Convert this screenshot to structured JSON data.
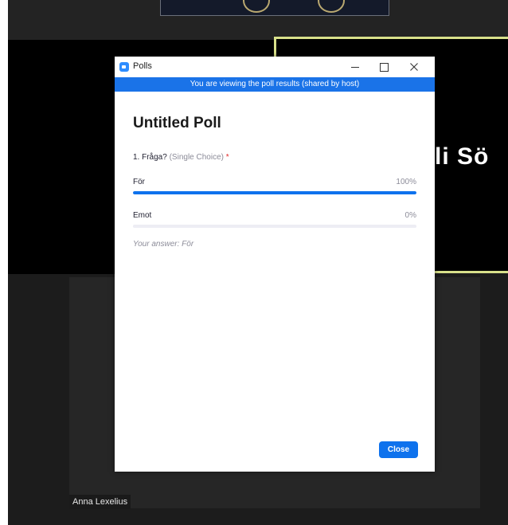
{
  "window": {
    "title": "Polls"
  },
  "banner": {
    "text": "You are viewing the poll results (shared by host)"
  },
  "poll": {
    "title": "Untitled Poll",
    "question": {
      "number_text": "1. Fråga?",
      "type": "(Single Choice)",
      "required_marker": "*"
    },
    "options": [
      {
        "label": "För",
        "percent_text": "100%",
        "percent": 100
      },
      {
        "label": "Emot",
        "percent_text": "0%",
        "percent": 0
      }
    ],
    "your_answer": "Your answer: För",
    "close_label": "Close"
  },
  "meeting": {
    "shared_text": "li Sö",
    "participant_name": "Anna Lexelius"
  },
  "colors": {
    "accent": "#0e72ed",
    "banner": "#1a73e8",
    "required": "#e02828",
    "shared_border": "#d8e08a"
  },
  "icons": {
    "app": "zoom-app-icon",
    "minimize": "minimize-icon",
    "maximize": "maximize-icon",
    "close": "close-icon"
  }
}
